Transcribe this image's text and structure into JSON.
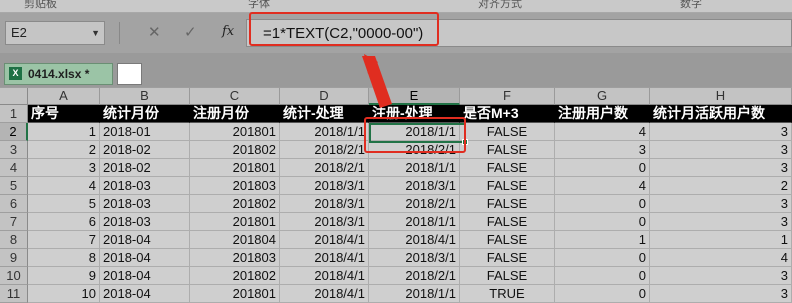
{
  "ribbon": {
    "clipboard_label": "剪贴板",
    "font_label": "字体",
    "alignment_label": "对齐方式",
    "number_label": "数字"
  },
  "formula_bar": {
    "name_box": "E2",
    "fx_label": "fx",
    "formula": "=1*TEXT(C2,\"0000-00\")"
  },
  "file_tab": {
    "name": "0414.xlsx *",
    "icon": "excel-file-icon"
  },
  "sheet": {
    "columns": [
      "A",
      "B",
      "C",
      "D",
      "E",
      "F",
      "G",
      "H"
    ],
    "selected_column": "E",
    "selected_row": "2",
    "header_row": {
      "row_number": "1",
      "cells": [
        "序号",
        "统计月份",
        "注册月份",
        "统计-处理",
        "注册-处理",
        "是否M+3",
        "注册用户数",
        "统计月活跃用户数"
      ]
    },
    "rows": [
      {
        "n": "2",
        "cells": [
          "1",
          "2018-01",
          "201801",
          "2018/1/1",
          "2018/1/1",
          "FALSE",
          "4",
          "3"
        ]
      },
      {
        "n": "3",
        "cells": [
          "2",
          "2018-02",
          "201802",
          "2018/2/1",
          "2018/2/1",
          "FALSE",
          "3",
          "3"
        ]
      },
      {
        "n": "4",
        "cells": [
          "3",
          "2018-02",
          "201801",
          "2018/2/1",
          "2018/1/1",
          "FALSE",
          "0",
          "3"
        ]
      },
      {
        "n": "5",
        "cells": [
          "4",
          "2018-03",
          "201803",
          "2018/3/1",
          "2018/3/1",
          "FALSE",
          "4",
          "2"
        ]
      },
      {
        "n": "6",
        "cells": [
          "5",
          "2018-03",
          "201802",
          "2018/3/1",
          "2018/2/1",
          "FALSE",
          "0",
          "3"
        ]
      },
      {
        "n": "7",
        "cells": [
          "6",
          "2018-03",
          "201801",
          "2018/3/1",
          "2018/1/1",
          "FALSE",
          "0",
          "3"
        ]
      },
      {
        "n": "8",
        "cells": [
          "7",
          "2018-04",
          "201804",
          "2018/4/1",
          "2018/4/1",
          "FALSE",
          "1",
          "1"
        ]
      },
      {
        "n": "9",
        "cells": [
          "8",
          "2018-04",
          "201803",
          "2018/4/1",
          "2018/3/1",
          "FALSE",
          "0",
          "4"
        ]
      },
      {
        "n": "10",
        "cells": [
          "9",
          "2018-04",
          "201802",
          "2018/4/1",
          "2018/2/1",
          "FALSE",
          "0",
          "3"
        ]
      },
      {
        "n": "11",
        "cells": [
          "10",
          "2018-04",
          "201801",
          "2018/4/1",
          "2018/1/1",
          "TRUE",
          "0",
          "3"
        ]
      }
    ]
  },
  "colors": {
    "highlight_red": "#e02d20",
    "selection_green": "#217346",
    "header_fill": "#000000"
  }
}
